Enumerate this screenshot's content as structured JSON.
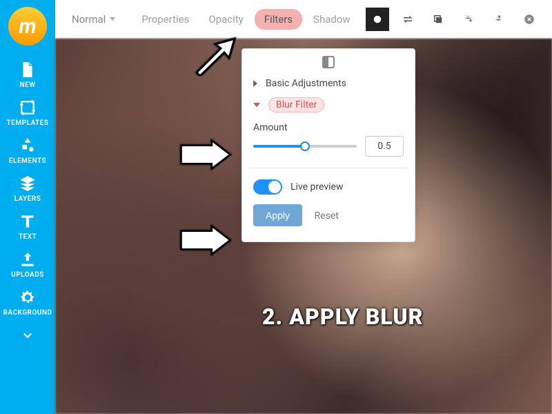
{
  "logo": "m",
  "sidebar": {
    "items": [
      {
        "label": "NEW",
        "icon": "file-icon"
      },
      {
        "label": "TEMPLATES",
        "icon": "crop-icon"
      },
      {
        "label": "ELEMENTS",
        "icon": "shapes-icon"
      },
      {
        "label": "LAYERS",
        "icon": "layers-icon"
      },
      {
        "label": "TEXT",
        "icon": "text-icon"
      },
      {
        "label": "UPLOADS",
        "icon": "upload-icon"
      },
      {
        "label": "BACKGROUND",
        "icon": "gear-icon"
      }
    ]
  },
  "toolbar": {
    "blend_mode": "Normal",
    "properties": "Properties",
    "opacity": "Opacity",
    "filters": "Filters",
    "shadow": "Shadow"
  },
  "panel": {
    "basic": "Basic Adjustments",
    "blur_filter": "Blur Filter",
    "amount_label": "Amount",
    "amount_value": "0.5",
    "live_preview": "Live preview",
    "apply": "Apply",
    "reset": "Reset"
  },
  "caption": "2. APPLY BLUR"
}
